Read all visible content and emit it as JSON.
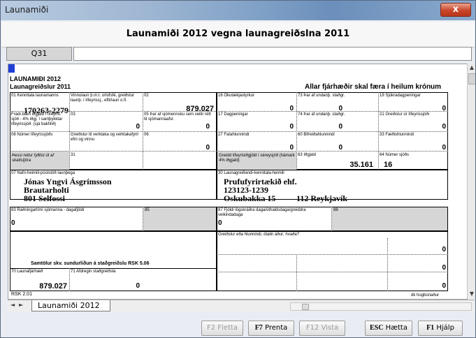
{
  "window": {
    "title": "Launamiði",
    "close_label": "x"
  },
  "header": {
    "title": "Launamiði 2012 vegna launagreiðslna 2011"
  },
  "cell": {
    "ref": "Q31",
    "value": ""
  },
  "form": {
    "heading1": "LAUNAMIÐI 2012",
    "heading2": "Launagreiðslur 2011",
    "heading_right": "Allar fjárhæðir skal færa í heilum krónum",
    "f01_label": "01 Kennitala launamanns",
    "f01_value": "170263-2279",
    "vinnulaun_label": "Vinnulaun þ.m.t. orlofsfé, greiðslur launþ. í lífeyrissj., eftirlaun o.fl.",
    "f02_label": "02",
    "f02_value": "879.027",
    "f16_label": "16 Ökutækjastyrkur",
    "f16_value": "0",
    "f73_label": "73 Þar af undanþ. staðgr.",
    "f73_value": "0",
    "f19_label": "19 Sjúkradagpeningar",
    "f19_value": "0",
    "fradr_label": "Frádr.bært iðgjald í lífeyris- sjóð - 4% iðgj. í samþykktar lífeyrissjóð. (sjá bakhlið)",
    "f03_label": "03",
    "f03_value": "0",
    "f05_label": "05 Þar af sjómennsku sem veitir rétt til sjómannaafsl.",
    "f05_value": "0",
    "f17_label": "17 Dagpeningar",
    "f17_value": "0",
    "f74_label": "74 Þar af undanþ. staðgr.",
    "f74_value": "0",
    "f21_label": "21 Greiðslur úr lífeyrissjóði",
    "f21_value": "0",
    "f08_label": "08 Númer lífeyrissjóðs",
    "verktak_label": "Greiðslur til verktaka og verktakafyrir efni og vinnu",
    "f06_label": "06",
    "f06_value": "0",
    "f27_label": "27 Fatahlunnindi",
    "f27_value": "0",
    "f60_label": "60 Bifreiðahlunnindi",
    "f60_value": "0",
    "f33_label": "33 Fæðishlunnindi",
    "f33_value": "0",
    "skattstjora_label": "Þessi reitur fylltist út af skattstjóra",
    "f31_label": "31",
    "greitt_label": "Greidd lífeyrisiðgjöld í séreysjóð (hámark 4% iðgjald)",
    "f63_label": "63 Iðgjald",
    "f63_value": "35.161",
    "f64_label": "64 Númer sjóðs",
    "f64_value": "16",
    "f07_label": "07 Nafn-heimili-póststöð launþega",
    "emp_name": "Jónas Yngvi Ásgrímsson",
    "emp_street": "Brautarholti",
    "emp_city": "801 Selfossi",
    "f30_label": "30 Launagreiðandi-kennitala-heimili",
    "er_name": "Prufufyrirtækið ehf.",
    "er_id": "123123-1239",
    "er_street": "Oskubakka 15",
    "er_city": "112 Reykjavík",
    "f83_label": "83 Ráðningartími sjómanna - dagafjöldi",
    "f83_value": "0",
    "f85_label": "85",
    "f87_label": "87 Fjöldi lögskráðra daga/úthaldsdaga/greiddra veikindadaga",
    "f87_value": "0",
    "f88_label": "88",
    "hlunn_label": "Greiðslur eða hlunnindi, ótalin áður; hvaða?",
    "hlunn_value1": "0",
    "hlunn_value2": "0",
    "hlunn_value3": "0",
    "samtolur_label": "Samtölur skv. sundurliðun á staðgreiðslu  RSK 5.06",
    "f70_label": "70 Launafjárhæð",
    "f70_value": "879.027",
    "f71_label": "71 Afdregin staðgreiðsla",
    "f71_value": "0",
    "rsk_label": "RSK 2.01",
    "software_label": "dk hugbúnaður"
  },
  "tabs": {
    "active": "Launamiði 2012"
  },
  "buttons": {
    "fletta": "F2  Fletta",
    "prenta_key": "F7",
    "prenta": "Prenta",
    "vista": "F12  Vista",
    "haetta_key": "ESC",
    "haetta": "Hætta",
    "hjalp_key": "F1",
    "hjalp": "Hjálp"
  }
}
